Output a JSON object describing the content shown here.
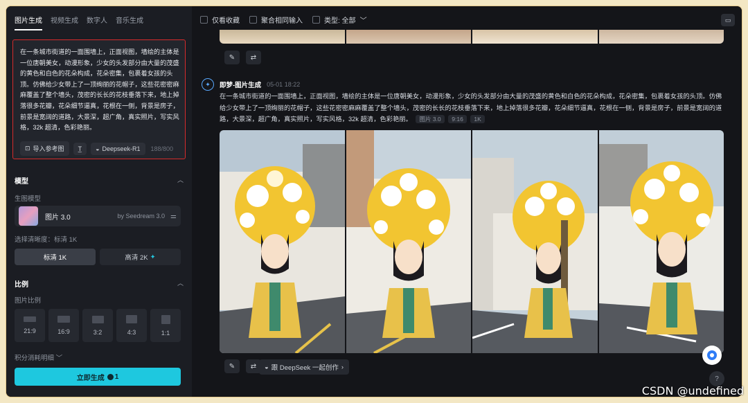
{
  "sidebar": {
    "tabs": [
      "图片生成",
      "视频生成",
      "数字人",
      "音乐生成"
    ],
    "prompt": {
      "text": "在一条城市街道的一面围墙上，正面视图，墙绘的主体是一位唐朝美女，动漫形象，少女的头发部分由大量的茂盛的黄色和白色的花朵构成，花朵密集，包裹着女孩的头顶。仿佛给少女带上了一顶绚丽的花帽子，这些花密密麻麻覆盖了整个墙头，茂密的长长的花枝垂落下来，地上掉落很多花瓣，花朵细节逼真，花根在一侧，背景是房子，前景是宽阔的道路，大景深，超广角，真实照片，写实风格，32k 超清，色彩艳丽。",
      "import_label": "导入参考图",
      "deepseek_label": "Deepseek-R1",
      "counter": "188/800"
    },
    "model": {
      "section_title": "模型",
      "sub_label": "生图模型",
      "name": "图片 3.0",
      "by": "by Seedream 3.0",
      "quality_label": "选择清晰度：标清 1K",
      "quality_options": [
        "标清 1K",
        "高清 2K"
      ]
    },
    "ratio": {
      "section_title": "比例",
      "sub_label": "图片比例",
      "options": [
        "21:9",
        "16:9",
        "3:2",
        "4:3",
        "1:1"
      ]
    },
    "cost_label": "积分消耗明细",
    "generate_label": "立即生成",
    "generate_cost": "1"
  },
  "main": {
    "filters": {
      "favorites": "仅看收藏",
      "aggregate": "聚合相同输入",
      "type": "类型: 全部"
    },
    "generation": {
      "title": "即梦-图片生成",
      "time": "05-01  18:22",
      "prompt": "在一条城市街道的一面围墙上，正面视图，墙绘的主体是一位唐朝美女，动漫形象，少女的头发部分由大量的茂盛的黄色和白色的花朵构成，花朵密集，包裹着女孩的头顶。仿佛给少女带上了一顶绚丽的花帽子，这些花密密麻麻覆盖了整个墙头，茂密的长长的花枝垂落下来，地上掉落很多花瓣，花朵细节逼真，花根在一侧，背景是房子，前景是宽阔的道路，大景深，超广角，真实照片，写实风格，32k 超清，色彩艳丽。",
      "tags": [
        "图片 3.0",
        "9:16",
        "1K"
      ],
      "deepseek_action": "跟 DeepSeek 一起创作"
    }
  },
  "watermark": "CSDN @undefined",
  "colors": {
    "accent": "#1ec8df",
    "highlight_border": "#d62c2c",
    "flower_yellow": "#f2c531"
  }
}
